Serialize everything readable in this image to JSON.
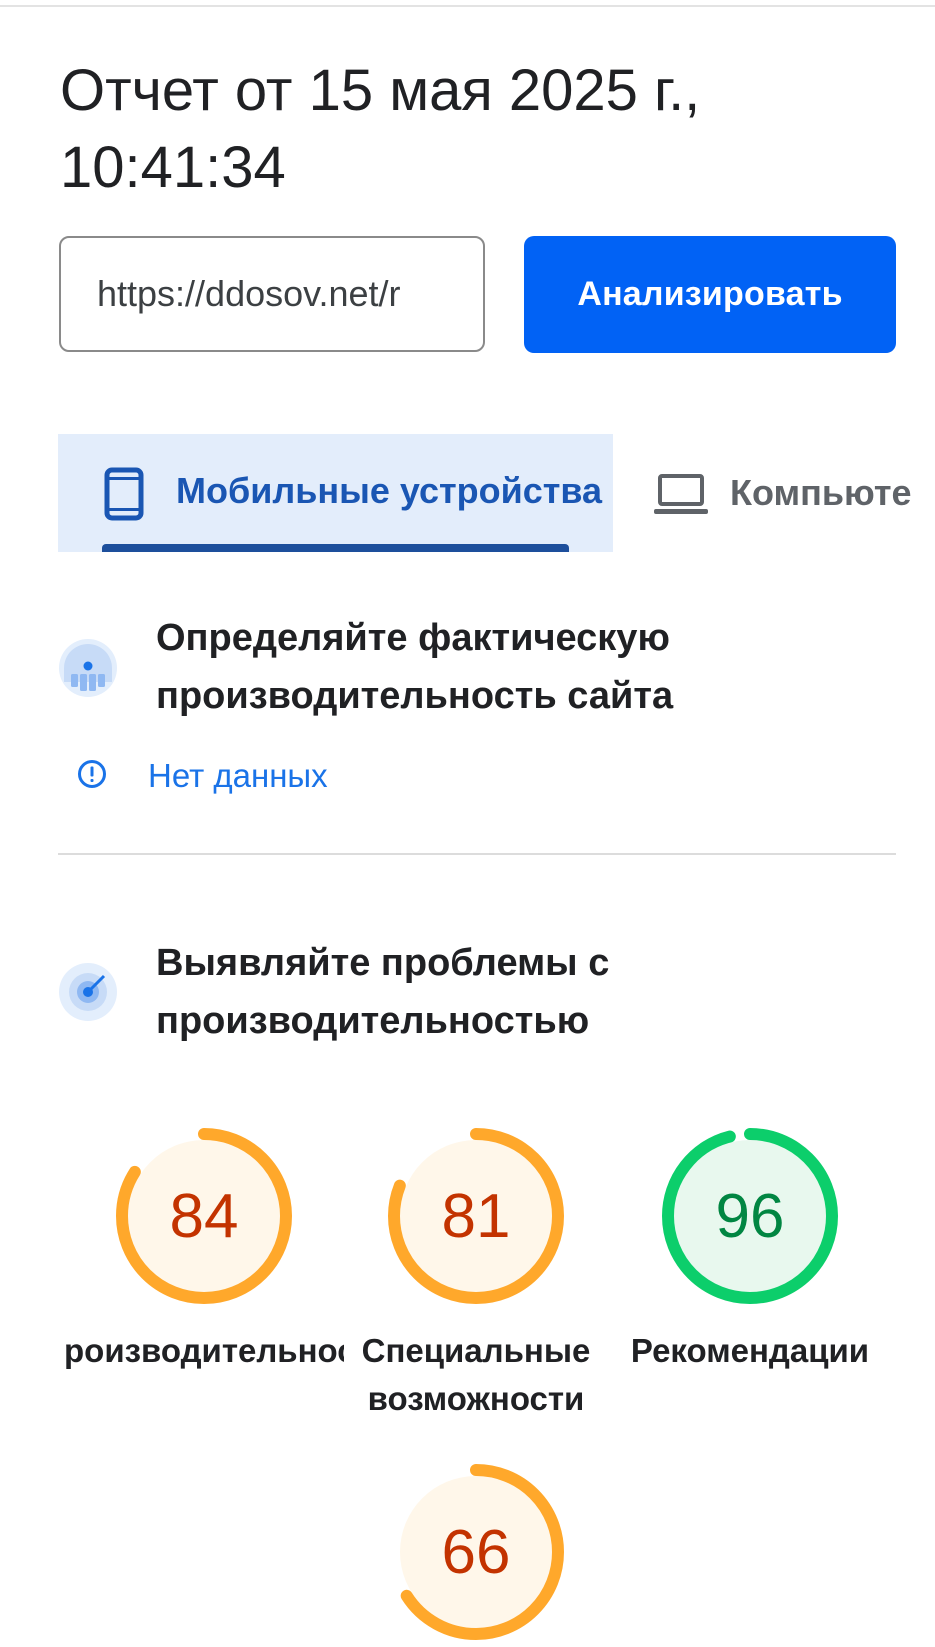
{
  "report": {
    "title": "Отчет от 15 мая 2025 г., 10:41:34"
  },
  "url_input": {
    "value": "https://ddosov.net/r"
  },
  "analyze_button": {
    "label": "Анализировать"
  },
  "tabs": [
    {
      "label": "Мобильные устройства",
      "icon": "smartphone-icon",
      "selected": true
    },
    {
      "label": "Компьюте",
      "icon": "laptop-icon",
      "selected": false
    }
  ],
  "field_data_section": {
    "heading": "Определяйте фактическую производительность сайта",
    "icon": "field-data-icon",
    "status": "Нет данных",
    "status_icon": "info-circle-icon"
  },
  "lab_section": {
    "heading": "Выявляйте проблемы с производительностью",
    "icon": "lab-diagnostics-icon"
  },
  "scores": [
    {
      "value": "84",
      "score": 84,
      "label": "Производительность",
      "visible_label": "роизводительнос",
      "ring": "#ffa82b",
      "fill": "#fff7ea",
      "text": "#c33300"
    },
    {
      "value": "81",
      "score": 81,
      "label": "Специальные возможности",
      "visible_label": "Специальные возможности",
      "ring": "#ffa82b",
      "fill": "#fff7ea",
      "text": "#c33300"
    },
    {
      "value": "96",
      "score": 96,
      "label": "Рекомендации",
      "visible_label": "Рекомендации",
      "ring": "#0cce6b",
      "fill": "#e8f8ee",
      "text": "#018642"
    },
    {
      "value": "66",
      "score": 66,
      "label": "",
      "visible_label": "",
      "ring": "#ffa82b",
      "fill": "#fff7ea",
      "text": "#c33300"
    }
  ],
  "colors": {
    "accent": "#0162f5",
    "tab_selected_bg": "#e3edfb",
    "tab_selected_text": "#1a56b3",
    "link": "#1a73e8"
  }
}
